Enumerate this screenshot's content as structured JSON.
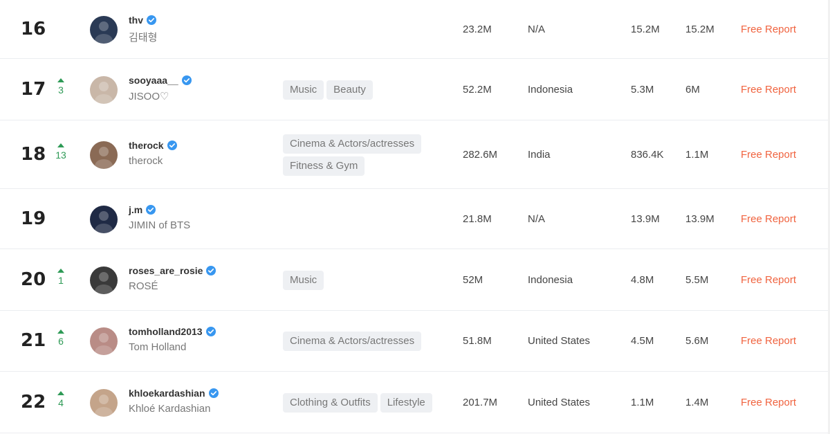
{
  "rows": [
    {
      "rank": "16",
      "delta": "",
      "handle": "thv",
      "name": "김태형",
      "tags": [],
      "followers": "23.2M",
      "country": "N/A",
      "avg_likes": "15.2M",
      "engagement": "15.2M",
      "report": "Free Report",
      "avatar_color": "#2a3a55"
    },
    {
      "rank": "17",
      "delta": "3",
      "handle": "sooyaaa__",
      "name": "JISOO♡",
      "tags": [
        "Music",
        "Beauty"
      ],
      "followers": "52.2M",
      "country": "Indonesia",
      "avg_likes": "5.3M",
      "engagement": "6M",
      "report": "Free Report",
      "avatar_color": "#c9b7a8"
    },
    {
      "rank": "18",
      "delta": "13",
      "handle": "therock",
      "name": "therock",
      "tags": [
        "Cinema & Actors/actresses",
        "Fitness & Gym"
      ],
      "followers": "282.6M",
      "country": "India",
      "avg_likes": "836.4K",
      "engagement": "1.1M",
      "report": "Free Report",
      "avatar_color": "#8a6a55"
    },
    {
      "rank": "19",
      "delta": "",
      "handle": "j.m",
      "name": "JIMIN of BTS",
      "tags": [],
      "followers": "21.8M",
      "country": "N/A",
      "avg_likes": "13.9M",
      "engagement": "13.9M",
      "report": "Free Report",
      "avatar_color": "#1f2a45"
    },
    {
      "rank": "20",
      "delta": "1",
      "handle": "roses_are_rosie",
      "name": "ROSÉ",
      "tags": [
        "Music"
      ],
      "followers": "52M",
      "country": "Indonesia",
      "avg_likes": "4.8M",
      "engagement": "5.5M",
      "report": "Free Report",
      "avatar_color": "#3a3a3a"
    },
    {
      "rank": "21",
      "delta": "6",
      "handle": "tomholland2013",
      "name": "Tom Holland",
      "tags": [
        "Cinema & Actors/actresses"
      ],
      "followers": "51.8M",
      "country": "United States",
      "avg_likes": "4.5M",
      "engagement": "5.6M",
      "report": "Free Report",
      "avatar_color": "#b98c86"
    },
    {
      "rank": "22",
      "delta": "4",
      "handle": "khloekardashian",
      "name": "Khloé Kardashian",
      "tags": [
        "Clothing & Outfits",
        "Lifestyle"
      ],
      "followers": "201.7M",
      "country": "United States",
      "avg_likes": "1.1M",
      "engagement": "1.4M",
      "report": "Free Report",
      "avatar_color": "#c4a48a"
    }
  ],
  "colors": {
    "accent": "#f0633f",
    "up": "#2e9a56",
    "verified": "#3897f0"
  }
}
